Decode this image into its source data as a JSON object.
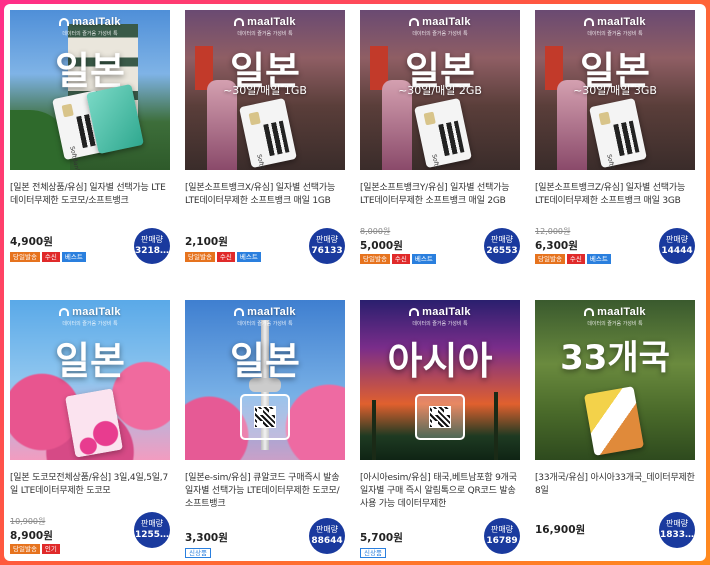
{
  "brand": {
    "logo": "maaITalk",
    "tagline": "데이터의 즐거움 가성비 톡"
  },
  "colors": {
    "badge": "#1a3a9e",
    "tag_orange": "#e6731e",
    "tag_red": "#e02a2a",
    "tag_blue": "#2a7fde"
  },
  "products": [
    {
      "big": "일본",
      "sub": "",
      "title": "[일본 전체상품/유심] 일자별 선택가능 LTE 데이터무제한 도코모/소프트뱅크",
      "old_price": "",
      "price": "4,900원",
      "sales_label": "판매량",
      "sales_count": "3218…",
      "tags": [
        "당일발송",
        "수신",
        "베스트"
      ]
    },
    {
      "big": "일본",
      "sub": "~30일/매일 1GB",
      "title": "[일본소프트뱅크X/유심] 일자별 선택가능 LTE데이터무제한 소프트뱅크 매일 1GB",
      "old_price": "",
      "price": "2,100원",
      "sales_label": "판매량",
      "sales_count": "76133",
      "tags": [
        "당일발송",
        "수신",
        "베스트"
      ]
    },
    {
      "big": "일본",
      "sub": "~30일/매일 2GB",
      "title": "[일본소프트뱅크Y/유심] 일자별 선택가능 LTE데이터무제한 소프트뱅크 매일 2GB",
      "old_price": "8,000원",
      "price": "5,000원",
      "sales_label": "판매량",
      "sales_count": "26553",
      "tags": [
        "당일발송",
        "수신",
        "베스트"
      ]
    },
    {
      "big": "일본",
      "sub": "~30일/매일 3GB",
      "title": "[일본소프트뱅크Z/유심] 일자별 선택가능 LTE데이터무제한 소프트뱅크 매일 3GB",
      "old_price": "12,000원",
      "price": "6,300원",
      "sales_label": "판매량",
      "sales_count": "14444",
      "tags": [
        "당일발송",
        "수신",
        "베스트"
      ]
    },
    {
      "big": "일본",
      "sub": "",
      "title": "[일본 도코모전체상품/유심] 3일,4일,5일,7일 LTE데이터무제한 도코모",
      "old_price": "10,900원",
      "price": "8,900원",
      "sales_label": "판매량",
      "sales_count": "1255…",
      "tags": [
        "당일발송",
        "인기"
      ]
    },
    {
      "big": "일본",
      "sub": "",
      "title": "[일본e-sim/유심] 큐알코드 구매즉시 발송 일자별 선택가능 LTE데이터무제한 도코모/소프트뱅크",
      "old_price": "",
      "price": "3,300원",
      "sales_label": "판매량",
      "sales_count": "88644",
      "tags": [
        "신상품"
      ]
    },
    {
      "big": "아시아",
      "sub": "",
      "title": "[아시아esim/유심] 태국,베트남포함 9개국 일자별 구매 즉시 알림톡으로 QR코드 발송 사용 가능 데이터무제한",
      "old_price": "",
      "price": "5,700원",
      "sales_label": "판매량",
      "sales_count": "16789",
      "tags": [
        "신상품"
      ]
    },
    {
      "big": "33개국",
      "sub": "",
      "title": "[33개국/유심] 아시아33개국_데이터무제한 8일",
      "old_price": "",
      "price": "16,900원",
      "sales_label": "판매량",
      "sales_count": "1833…",
      "tags": []
    }
  ]
}
